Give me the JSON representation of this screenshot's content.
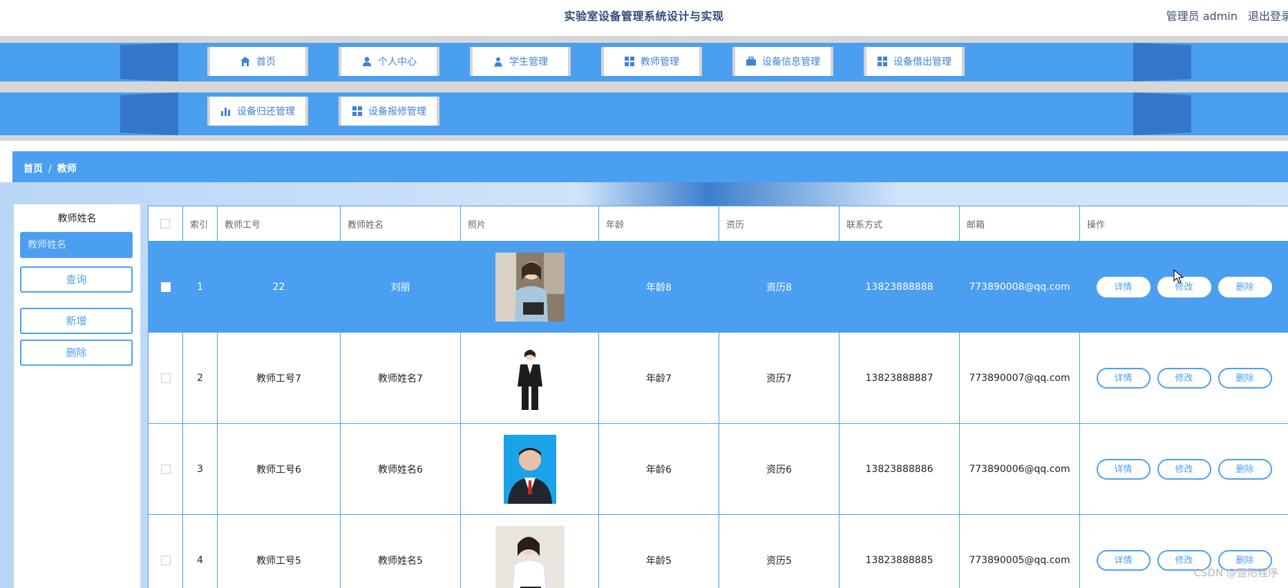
{
  "header": {
    "title": "实验室设备管理系统设计与实现",
    "user": "管理员 admin",
    "logout": "退出登录"
  },
  "nav": {
    "row1": [
      {
        "label": "首页",
        "icon": "home-icon"
      },
      {
        "label": "个人中心",
        "icon": "user-icon"
      },
      {
        "label": "学生管理",
        "icon": "student-icon"
      },
      {
        "label": "教师管理",
        "icon": "grid-icon"
      },
      {
        "label": "设备信息管理",
        "icon": "briefcase-icon"
      },
      {
        "label": "设备借出管理",
        "icon": "grid-icon"
      }
    ],
    "row2": [
      {
        "label": "设备归还管理",
        "icon": "bar-chart-icon"
      },
      {
        "label": "设备报修管理",
        "icon": "grid-icon"
      }
    ]
  },
  "breadcrumb": {
    "home": "首页",
    "sep": "/",
    "current": "教师"
  },
  "search": {
    "label": "教师姓名",
    "placeholder": "教师姓名",
    "query_button": "查询",
    "add_button": "新增",
    "delete_button": "删除"
  },
  "table": {
    "columns": [
      "索引",
      "教师工号",
      "教师姓名",
      "照片",
      "年龄",
      "资历",
      "联系方式",
      "邮箱",
      "操作"
    ],
    "actions": {
      "detail": "详情",
      "edit": "修改",
      "delete": "删除"
    },
    "rows": [
      {
        "index": "1",
        "job_no": "22",
        "name": "刘丽",
        "age": "年龄8",
        "seniority": "资历8",
        "phone": "13823888888",
        "email": "773890008@qq.com",
        "selected": true
      },
      {
        "index": "2",
        "job_no": "教师工号7",
        "name": "教师姓名7",
        "age": "年龄7",
        "seniority": "资历7",
        "phone": "13823888887",
        "email": "773890007@qq.com",
        "selected": false
      },
      {
        "index": "3",
        "job_no": "教师工号6",
        "name": "教师姓名6",
        "age": "年龄6",
        "seniority": "资历6",
        "phone": "13823888886",
        "email": "773890006@qq.com",
        "selected": false
      },
      {
        "index": "4",
        "job_no": "教师工号5",
        "name": "教师姓名5",
        "age": "年龄5",
        "seniority": "资历5",
        "phone": "13823888885",
        "email": "773890005@qq.com",
        "selected": false
      }
    ]
  },
  "watermark": "CSDN @暨阳程序",
  "colors": {
    "accent": "#4b9ff0",
    "accent_dark": "#3477c8",
    "title": "#2d4a78"
  }
}
